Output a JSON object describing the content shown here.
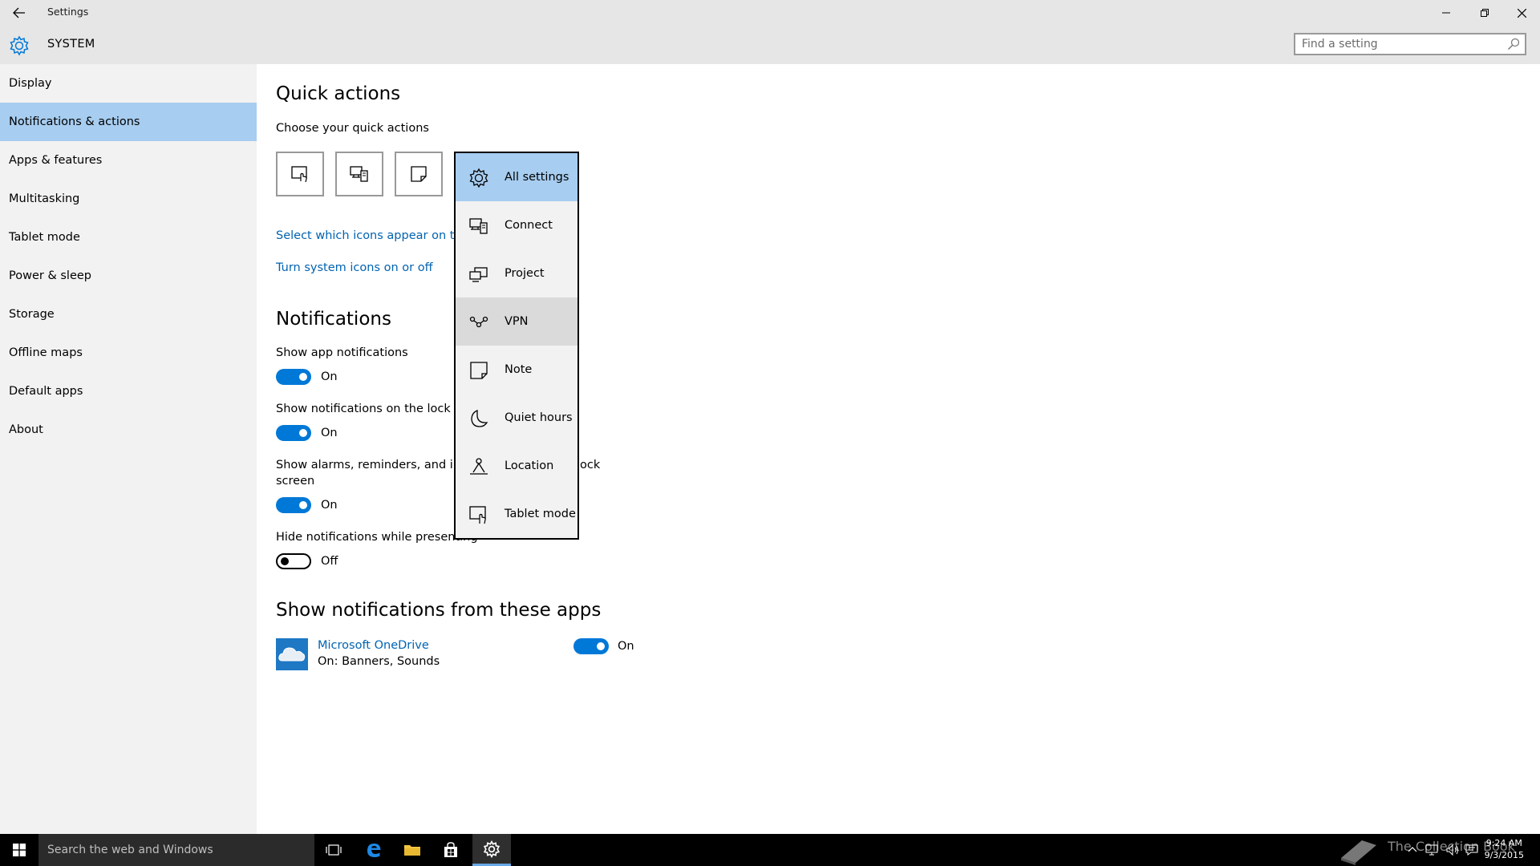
{
  "window": {
    "title": "Settings",
    "section": "SYSTEM"
  },
  "search": {
    "placeholder": "Find a setting"
  },
  "sidebar": {
    "items": [
      {
        "label": "Display"
      },
      {
        "label": "Notifications & actions",
        "selected": true
      },
      {
        "label": "Apps & features"
      },
      {
        "label": "Multitasking"
      },
      {
        "label": "Tablet mode"
      },
      {
        "label": "Power & sleep"
      },
      {
        "label": "Storage"
      },
      {
        "label": "Offline maps"
      },
      {
        "label": "Default apps"
      },
      {
        "label": "About"
      }
    ]
  },
  "quick_actions": {
    "heading": "Quick actions",
    "subheading": "Choose your quick actions",
    "tiles": [
      "tablet-mode-icon",
      "connect-icon",
      "note-icon"
    ],
    "link1": "Select which icons appear on the",
    "link2": "Turn system icons on or off"
  },
  "notifications": {
    "heading": "Notifications",
    "settings": [
      {
        "label": "Show app notifications",
        "state": "On"
      },
      {
        "label": "Show notifications on the lock scr",
        "state": "On"
      },
      {
        "label_line1": "Show alarms, reminders, and inco",
        "label_tail": "ock",
        "label_line2": "screen",
        "state": "On"
      },
      {
        "label": "Hide notifications while presenting",
        "state": "Off"
      }
    ]
  },
  "apps_section": {
    "heading": "Show notifications from these apps",
    "apps": [
      {
        "name": "Microsoft OneDrive",
        "detail": "On: Banners, Sounds",
        "state": "On"
      }
    ]
  },
  "dropdown": {
    "items": [
      {
        "label": "All settings",
        "icon": "gear-icon",
        "highlight": true
      },
      {
        "label": "Connect",
        "icon": "connect-icon"
      },
      {
        "label": "Project",
        "icon": "project-icon"
      },
      {
        "label": "VPN",
        "icon": "vpn-icon",
        "hover": true
      },
      {
        "label": "Note",
        "icon": "note-icon"
      },
      {
        "label": "Quiet hours",
        "icon": "moon-icon"
      },
      {
        "label": "Location",
        "icon": "location-icon"
      },
      {
        "label": "Tablet mode",
        "icon": "tablet-mode-icon"
      }
    ]
  },
  "taskbar": {
    "search_placeholder": "Search the web and Windows",
    "clock_time": "9:24 AM",
    "clock_date": "9/3/2015",
    "watermark": "The Collection Book"
  },
  "colors": {
    "accent": "#0078d7",
    "selection": "#a7cdf0",
    "link": "#0063b1"
  }
}
